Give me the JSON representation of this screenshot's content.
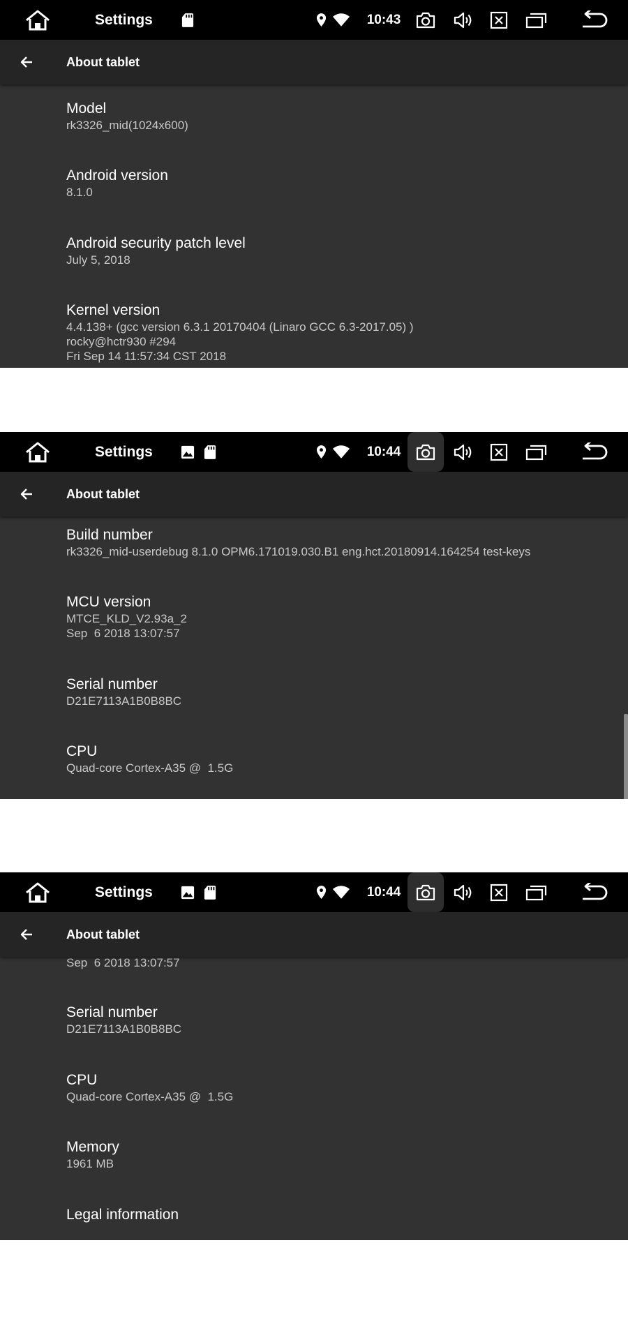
{
  "colors": {
    "status_bar": "#000000",
    "action_bar": "#252525",
    "content_bg": "#323232",
    "title_text": "#ffffff",
    "summary_text": "#c8c8c8"
  },
  "screens": [
    {
      "status": {
        "title": "Settings",
        "time": "10:43"
      },
      "action_bar": {
        "title": "About tablet"
      },
      "items": [
        {
          "title": "Model",
          "summary": "rk3326_mid(1024x600)"
        },
        {
          "title": "Android version",
          "summary": "8.1.0"
        },
        {
          "title": "Android security patch level",
          "summary": "July 5, 2018"
        },
        {
          "title": "Kernel version",
          "summary": "4.4.138+ (gcc version 6.3.1 20170404 (Linaro GCC 6.3-2017.05) )\nrocky@hctr930 #294\nFri Sep 14 11:57:34 CST 2018"
        }
      ]
    },
    {
      "status": {
        "title": "Settings",
        "time": "10:44"
      },
      "action_bar": {
        "title": "About tablet"
      },
      "items": [
        {
          "title": "Build number",
          "summary": "rk3326_mid-userdebug 8.1.0 OPM6.171019.030.B1 eng.hct.20180914.164254 test-keys"
        },
        {
          "title": "MCU version",
          "summary": "MTCE_KLD_V2.93a_2\nSep  6 2018 13:07:57"
        },
        {
          "title": "Serial number",
          "summary": "D21E7113A1B0B8BC"
        },
        {
          "title": "CPU",
          "summary": "Quad-core Cortex-A35 @  1.5G"
        }
      ]
    },
    {
      "status": {
        "title": "Settings",
        "time": "10:44"
      },
      "action_bar": {
        "title": "About tablet"
      },
      "partial_summary": "Sep  6 2018 13:07:57",
      "items": [
        {
          "title": "Serial number",
          "summary": "D21E7113A1B0B8BC"
        },
        {
          "title": "CPU",
          "summary": "Quad-core Cortex-A35 @  1.5G"
        },
        {
          "title": "Memory",
          "summary": "1961 MB"
        },
        {
          "title": "Legal information"
        }
      ]
    }
  ]
}
